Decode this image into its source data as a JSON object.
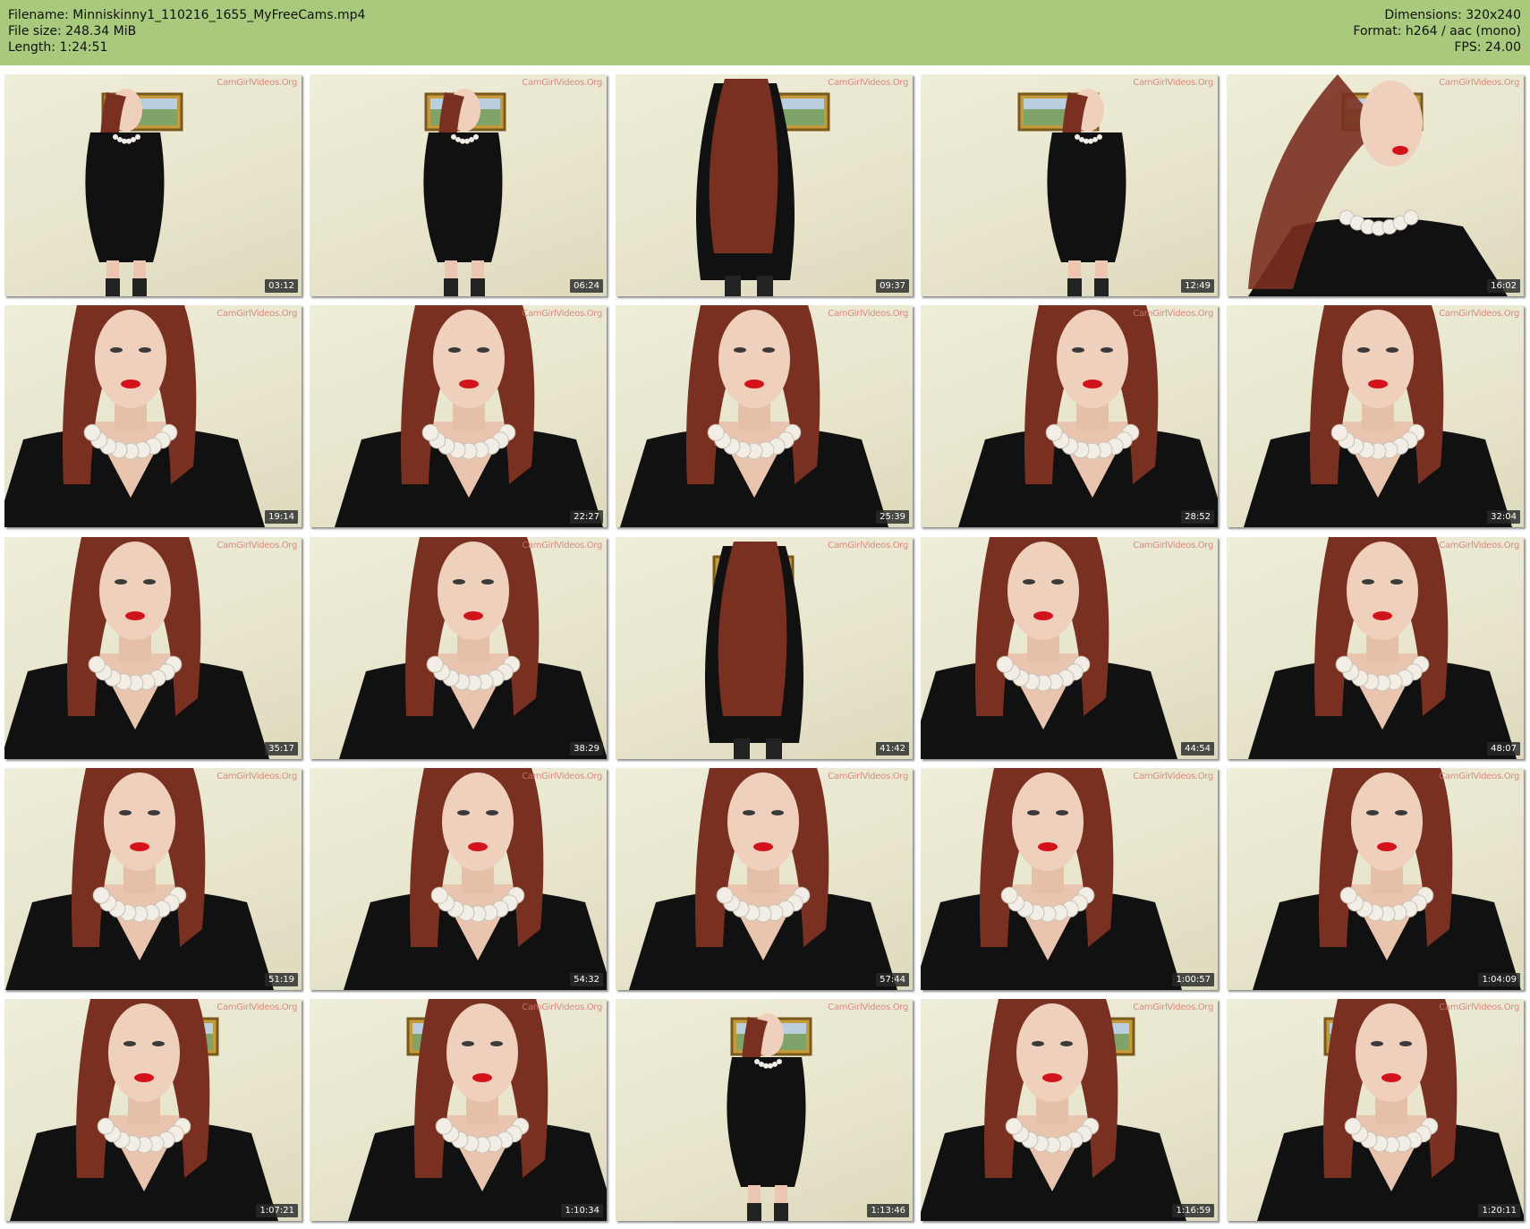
{
  "header": {
    "filename": "Filename: Minniskinny1_110216_1655_MyFreeCams.mp4",
    "file_size": "File size: 248.34 MiB",
    "length": "Length: 1:24:51",
    "dimensions": "Dimensions: 320x240",
    "format": "Format: h264 / aac (mono)",
    "fps": "FPS: 24.00"
  },
  "colors": {
    "header_bg": "#a9c97d",
    "wall": "#e6e3c9",
    "dress": "#111111",
    "hair": "#7a3020"
  },
  "watermark": "CamGirlVideos.Org",
  "thumbnails": [
    {
      "timestamp": "03:12",
      "shot": "full",
      "frame": true
    },
    {
      "timestamp": "06:24",
      "shot": "full",
      "frame": true
    },
    {
      "timestamp": "09:37",
      "shot": "back",
      "frame": true
    },
    {
      "timestamp": "12:49",
      "shot": "full",
      "frame": true
    },
    {
      "timestamp": "16:02",
      "shot": "motion",
      "frame": true
    },
    {
      "timestamp": "19:14",
      "shot": "close",
      "frame": false
    },
    {
      "timestamp": "22:27",
      "shot": "close",
      "frame": false
    },
    {
      "timestamp": "25:39",
      "shot": "close",
      "frame": false
    },
    {
      "timestamp": "28:52",
      "shot": "close",
      "frame": false
    },
    {
      "timestamp": "32:04",
      "shot": "close",
      "frame": false
    },
    {
      "timestamp": "35:17",
      "shot": "close",
      "frame": false
    },
    {
      "timestamp": "38:29",
      "shot": "close",
      "frame": false
    },
    {
      "timestamp": "41:42",
      "shot": "back",
      "frame": true
    },
    {
      "timestamp": "44:54",
      "shot": "close",
      "frame": false
    },
    {
      "timestamp": "48:07",
      "shot": "close",
      "frame": false
    },
    {
      "timestamp": "51:19",
      "shot": "close",
      "frame": true
    },
    {
      "timestamp": "54:32",
      "shot": "close",
      "frame": false
    },
    {
      "timestamp": "57:44",
      "shot": "close",
      "frame": false
    },
    {
      "timestamp": "1:00:57",
      "shot": "close",
      "frame": true
    },
    {
      "timestamp": "1:04:09",
      "shot": "close",
      "frame": false
    },
    {
      "timestamp": "1:07:21",
      "shot": "close",
      "frame": true
    },
    {
      "timestamp": "1:10:34",
      "shot": "close",
      "frame": true
    },
    {
      "timestamp": "1:13:46",
      "shot": "full",
      "frame": true
    },
    {
      "timestamp": "1:16:59",
      "shot": "close",
      "frame": true
    },
    {
      "timestamp": "1:20:11",
      "shot": "close",
      "frame": true
    }
  ]
}
